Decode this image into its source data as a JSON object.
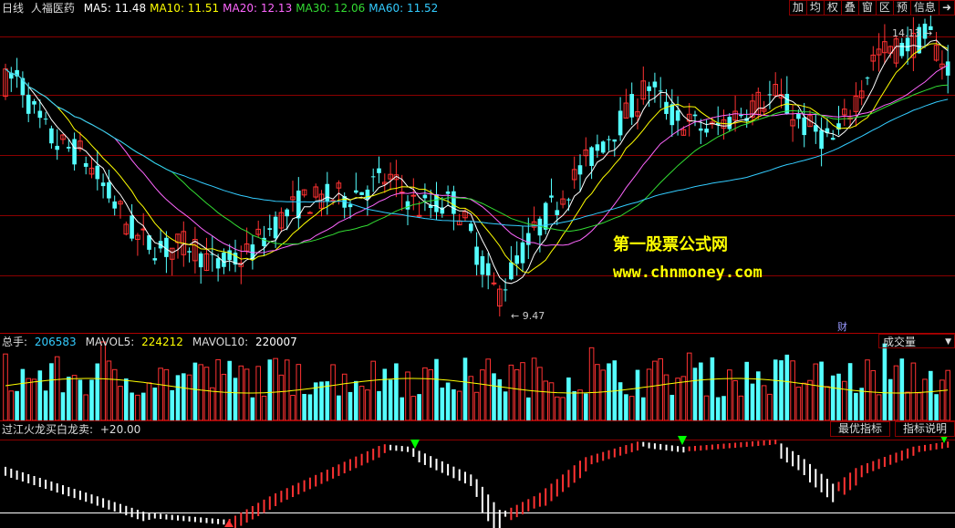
{
  "price_header": {
    "period": "日线",
    "stock": "人福医药",
    "ma": [
      {
        "label": "MA5:",
        "value": "11.48",
        "color": "#ffffff"
      },
      {
        "label": "MA10:",
        "value": "11.51",
        "color": "#ffff00"
      },
      {
        "label": "MA20:",
        "value": "12.13",
        "color": "#ff66ff"
      },
      {
        "label": "MA30:",
        "value": "12.06",
        "color": "#33dd33"
      },
      {
        "label": "MA60:",
        "value": "11.52",
        "color": "#33ccff"
      }
    ]
  },
  "toolbar": {
    "buttons": [
      "加",
      "均",
      "权",
      "叠",
      "窗",
      "区",
      "预",
      "信息"
    ],
    "exit_icon": "exit-arrow-icon"
  },
  "price_labels": {
    "high": "14.13",
    "low": "9.47",
    "cai": "财"
  },
  "watermark": {
    "line1": "第一股票公式网",
    "line2": "www.chnmoney.com"
  },
  "volume_header": {
    "items": [
      {
        "label": "总手:",
        "value": "206583",
        "color": "#33ccff"
      },
      {
        "label": "MAVOL5:",
        "value": "224212",
        "color": "#ffff00"
      },
      {
        "label": "MAVOL10:",
        "value": "220007",
        "color": "#ffffff"
      }
    ],
    "selector": "成交量"
  },
  "indicator_header": {
    "name": "过江火龙买白龙卖:",
    "value": "+20.00",
    "buttons": [
      "最优指标",
      "指标说明"
    ]
  },
  "colors": {
    "up": "#ff3232",
    "down": "#54ffff",
    "grid": "#8b0000"
  },
  "chart_data": {
    "type": "candlestick",
    "title": "人福医药",
    "ylim": [
      9.0,
      14.6
    ],
    "high_marker": 14.13,
    "low_marker": 9.47
  }
}
